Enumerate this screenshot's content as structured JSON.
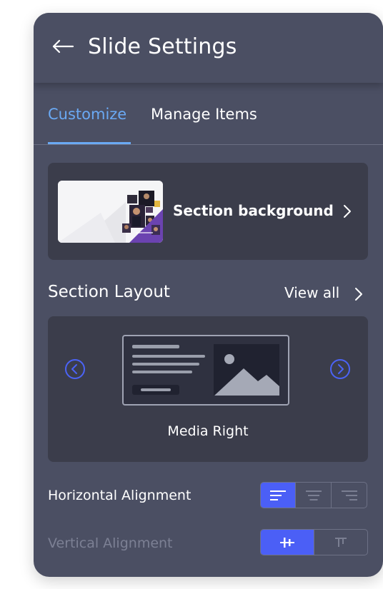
{
  "header": {
    "title": "Slide Settings",
    "back_icon": "arrow-left-icon"
  },
  "tabs": [
    {
      "label": "Customize",
      "active": true
    },
    {
      "label": "Manage Items",
      "active": false
    }
  ],
  "background_card": {
    "label": "Section background",
    "icon": "chevron-right-icon"
  },
  "layout": {
    "title": "Section Layout",
    "view_all": "View all",
    "current": "Media Right",
    "prev_icon": "circle-chevron-left-icon",
    "next_icon": "circle-chevron-right-icon"
  },
  "horizontal_alignment": {
    "label": "Horizontal Alignment",
    "options": [
      "align-left-icon",
      "align-center-icon",
      "align-right-icon"
    ],
    "selected": "align-left-icon"
  },
  "vertical_alignment": {
    "label": "Vertical Alignment",
    "disabled": true,
    "options": [
      "align-middle-icon",
      "align-top-icon"
    ],
    "selected": "align-middle-icon"
  },
  "colors": {
    "panel": "#4b4f63",
    "card": "#3b3d4b",
    "accent_tab": "#6aa9f4",
    "accent_button": "#4b5ff6"
  }
}
